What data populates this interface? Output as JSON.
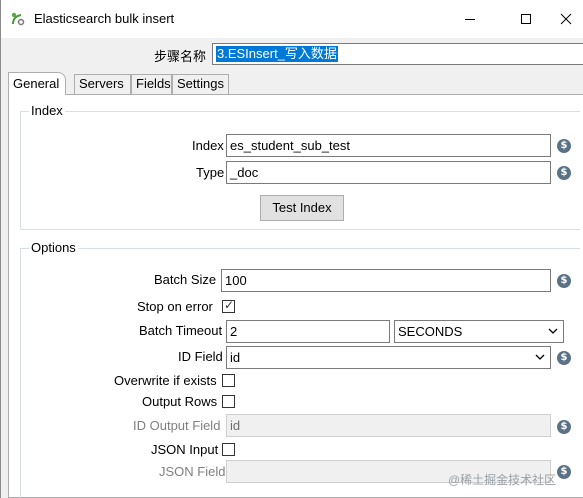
{
  "window": {
    "title": "Elasticsearch bulk insert",
    "app_icon": "kettle-icon",
    "controls": [
      "minimize-icon",
      "maximize-icon",
      "close-icon"
    ]
  },
  "step": {
    "label": "步骤名称",
    "value": "3.ESInsert_写入数据"
  },
  "tabs": [
    {
      "label": "General",
      "active": true
    },
    {
      "label": "Servers",
      "active": false
    },
    {
      "label": "Fields",
      "active": false
    },
    {
      "label": "Settings",
      "active": false
    }
  ],
  "index_group": {
    "title": "Index",
    "index_label": "Index",
    "index_value": "es_student_sub_test",
    "type_label": "Type",
    "type_value": "_doc",
    "test_button": "Test Index"
  },
  "options_group": {
    "title": "Options",
    "batch_size_label": "Batch Size",
    "batch_size_value": "100",
    "stop_on_error_label": "Stop on error",
    "stop_on_error_checked": true,
    "batch_timeout_label": "Batch Timeout",
    "batch_timeout_value": "2",
    "timeout_unit": "SECONDS",
    "id_field_label": "ID Field",
    "id_field_value": "id",
    "overwrite_label": "Overwrite if exists",
    "overwrite_checked": false,
    "output_rows_label": "Output Rows",
    "output_rows_checked": false,
    "id_output_label": "ID Output Field",
    "id_output_value": "id",
    "json_input_label": "JSON Input",
    "json_input_checked": false,
    "json_field_label": "JSON Field",
    "json_field_value": ""
  },
  "variable_icon_glyph": "$",
  "checkmark_glyph": "✓",
  "watermark": "@稀土掘金技术社区"
}
